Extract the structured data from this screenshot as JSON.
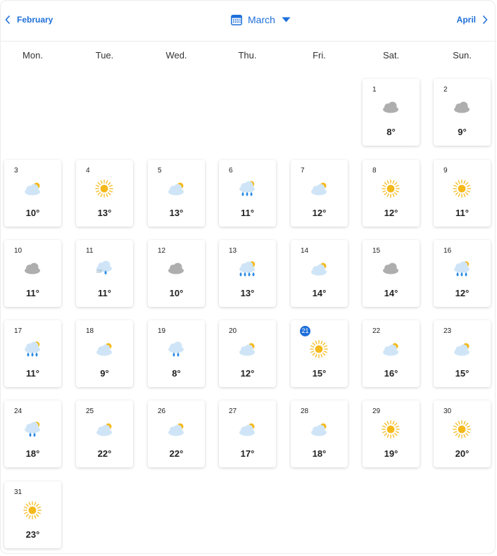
{
  "nav": {
    "prev_label": "February",
    "next_label": "April",
    "current_month": "March"
  },
  "weekdays": [
    "Mon.",
    "Tue.",
    "Wed.",
    "Thu.",
    "Fri.",
    "Sat.",
    "Sun."
  ],
  "colors": {
    "accent": "#1e6fd9",
    "sun": "#f5b91c",
    "cloud_grey": "#aeaeae",
    "cloud_light": "#cfe5f7",
    "rain": "#2b8ae2"
  },
  "today": "21",
  "days": [
    {
      "day": "1",
      "temp": "8°",
      "icon": "cloudy-icon"
    },
    {
      "day": "2",
      "temp": "9°",
      "icon": "cloudy-icon"
    },
    {
      "day": "3",
      "temp": "10°",
      "icon": "partly-cloudy-icon"
    },
    {
      "day": "4",
      "temp": "13°",
      "icon": "sunny-icon"
    },
    {
      "day": "5",
      "temp": "13°",
      "icon": "partly-cloudy-icon"
    },
    {
      "day": "6",
      "temp": "11°",
      "icon": "partly-cloudy-rain-icon"
    },
    {
      "day": "7",
      "temp": "12°",
      "icon": "partly-cloudy-icon"
    },
    {
      "day": "8",
      "temp": "12°",
      "icon": "sunny-icon"
    },
    {
      "day": "9",
      "temp": "11°",
      "icon": "sunny-icon"
    },
    {
      "day": "10",
      "temp": "11°",
      "icon": "cloudy-icon"
    },
    {
      "day": "11",
      "temp": "11°",
      "icon": "fog-drizzle-icon"
    },
    {
      "day": "12",
      "temp": "10°",
      "icon": "cloudy-icon"
    },
    {
      "day": "13",
      "temp": "13°",
      "icon": "partly-cloudy-heavy-rain-icon"
    },
    {
      "day": "14",
      "temp": "14°",
      "icon": "partly-cloudy-icon"
    },
    {
      "day": "15",
      "temp": "14°",
      "icon": "cloudy-icon"
    },
    {
      "day": "16",
      "temp": "12°",
      "icon": "partly-cloudy-rain-icon"
    },
    {
      "day": "17",
      "temp": "11°",
      "icon": "partly-cloudy-rain-icon"
    },
    {
      "day": "18",
      "temp": "9°",
      "icon": "partly-cloudy-icon"
    },
    {
      "day": "19",
      "temp": "8°",
      "icon": "cloud-rain-icon"
    },
    {
      "day": "20",
      "temp": "12°",
      "icon": "partly-cloudy-icon"
    },
    {
      "day": "21",
      "temp": "15°",
      "icon": "sunny-icon"
    },
    {
      "day": "22",
      "temp": "16°",
      "icon": "partly-cloudy-icon"
    },
    {
      "day": "23",
      "temp": "15°",
      "icon": "partly-cloudy-icon"
    },
    {
      "day": "24",
      "temp": "18°",
      "icon": "partly-cloudy-light-rain-icon"
    },
    {
      "day": "25",
      "temp": "22°",
      "icon": "partly-cloudy-icon"
    },
    {
      "day": "26",
      "temp": "22°",
      "icon": "partly-cloudy-icon"
    },
    {
      "day": "27",
      "temp": "17°",
      "icon": "partly-cloudy-icon"
    },
    {
      "day": "28",
      "temp": "18°",
      "icon": "partly-cloudy-icon"
    },
    {
      "day": "29",
      "temp": "19°",
      "icon": "sunny-icon"
    },
    {
      "day": "30",
      "temp": "20°",
      "icon": "sunny-icon"
    },
    {
      "day": "31",
      "temp": "23°",
      "icon": "sunny-icon"
    }
  ]
}
